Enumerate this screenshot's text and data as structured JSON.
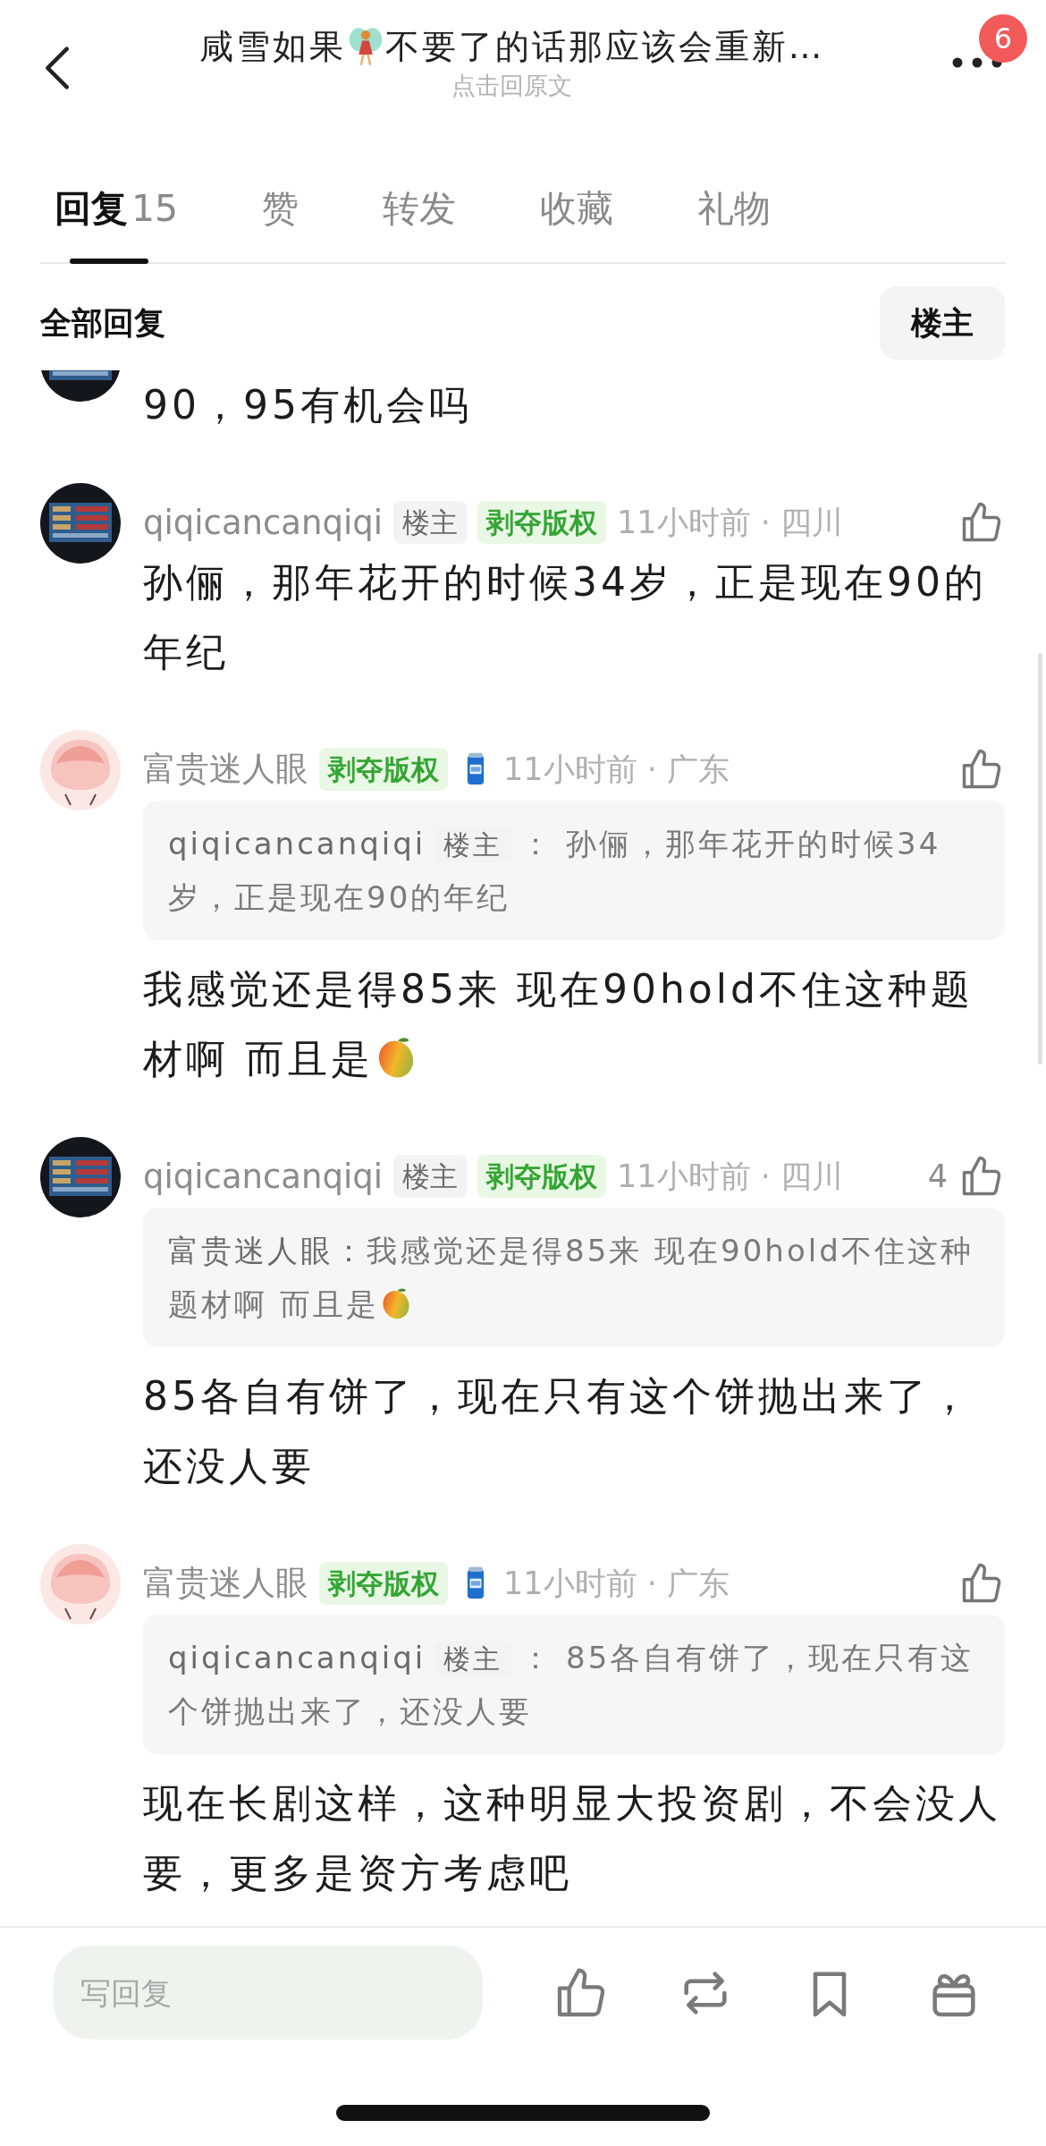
{
  "header": {
    "title_parts": [
      "咸雪如果",
      "不要了的话那应该会重新…"
    ],
    "subtitle": "点击回原文",
    "badge": "6"
  },
  "tabs": [
    {
      "label": "回复",
      "count": "15",
      "selected": true
    },
    {
      "label": "赞",
      "selected": false
    },
    {
      "label": "转发",
      "selected": false
    },
    {
      "label": "收藏",
      "selected": false
    },
    {
      "label": "礼物",
      "selected": false
    }
  ],
  "filter": {
    "label": "全部回复",
    "button": "楼主"
  },
  "comments": [
    {
      "kind": "partial",
      "avatar": {
        "kind": "screenshot"
      },
      "body": "90，95有机会吗"
    },
    {
      "kind": "full",
      "avatar": {
        "kind": "screenshot"
      },
      "name": "qiqicancanqiqi",
      "tags": [
        {
          "label": "楼主",
          "kind": "op"
        },
        {
          "label": "剥夺版权",
          "kind": "award"
        }
      ],
      "time": "11小时前 · 四川",
      "body": "孙俪，那年花开的时候34岁，正是现在90的年纪"
    },
    {
      "kind": "full",
      "avatar": {
        "kind": "cartoon"
      },
      "name": "富贵迷人眼",
      "tags": [
        {
          "label": "剥夺版权",
          "kind": "award"
        }
      ],
      "badge": {
        "kind": "can"
      },
      "time": "11小时前 · 广东",
      "quote": {
        "author": "qiqicancanqiqi",
        "tag": "楼主",
        "text": "： 孙俪，那年花开的时候34岁，正是现在90的年纪"
      },
      "body": "我感觉还是得85来 现在90hold不住这种题材啊 而且是",
      "sticker": {
        "kind": "mango"
      }
    },
    {
      "kind": "full",
      "avatar": {
        "kind": "screenshot"
      },
      "name": "qiqicancanqiqi",
      "tags": [
        {
          "label": "楼主",
          "kind": "op"
        },
        {
          "label": "剥夺版权",
          "kind": "award"
        }
      ],
      "time": "11小时前 · 四川",
      "likes": "4",
      "quote": {
        "author": "富贵迷人眼：",
        "text": "我感觉还是得85来 现在90hold不住这种题材啊 而且是",
        "sticker": {
          "kind": "mango"
        }
      },
      "body": "85各自有饼了，现在只有这个饼抛出来了，还没人要"
    },
    {
      "kind": "full",
      "avatar": {
        "kind": "cartoon"
      },
      "name": "富贵迷人眼",
      "tags": [
        {
          "label": "剥夺版权",
          "kind": "award"
        }
      ],
      "badge": {
        "kind": "can"
      },
      "time": "11小时前 · 广东",
      "quote": {
        "author": "qiqicancanqiqi",
        "tag": "楼主",
        "text": "： 85各自有饼了，现在只有这个饼抛出来了，还没人要"
      },
      "body": "现在长剧这样，这种明显大投资剧，不会没人要，更多是资方考虑吧"
    }
  ],
  "reply_box": {
    "placeholder": "写回复"
  }
}
